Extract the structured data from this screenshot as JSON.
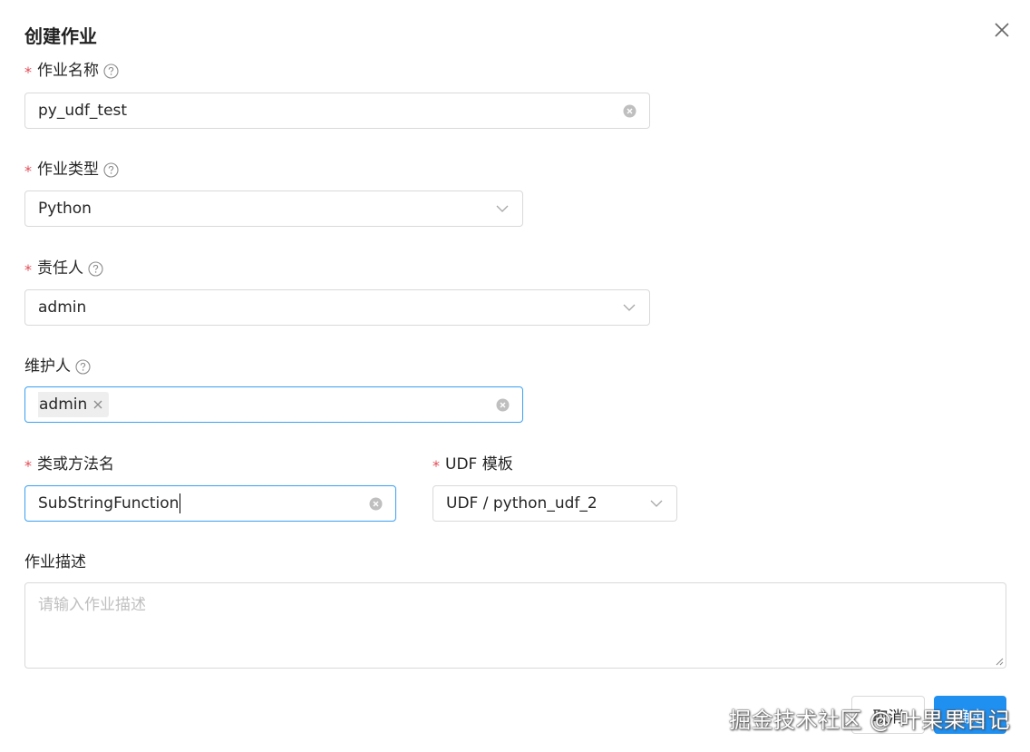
{
  "dialog": {
    "title": "创建作业",
    "close_icon": "close-icon"
  },
  "fields": {
    "job_name": {
      "label": "作业名称",
      "required": true,
      "value": "py_udf_test"
    },
    "job_type": {
      "label": "作业类型",
      "required": true,
      "value": "Python"
    },
    "owner": {
      "label": "责任人",
      "required": true,
      "value": "admin"
    },
    "maintainer": {
      "label": "维护人",
      "required": false,
      "tags": [
        "admin"
      ]
    },
    "class_method": {
      "label": "类或方法名",
      "required": true,
      "value": "SubStringFunction"
    },
    "udf_template": {
      "label": "UDF 模板",
      "required": true,
      "value": "UDF / python_udf_2"
    },
    "description": {
      "label": "作业描述",
      "required": false,
      "value": "",
      "placeholder": "请输入作业描述"
    }
  },
  "required_marker": "*",
  "footer": {
    "cancel_label": "取消",
    "ok_label": "确定"
  },
  "watermark": "掘金技术社区 @ 叶果果日记",
  "colors": {
    "accent": "#1f8ff0",
    "focus_border": "#3aa0f3",
    "required": "#e34d59",
    "border": "#d9d9d9",
    "tag_bg": "#eeeeee",
    "placeholder": "#bfbfbf"
  }
}
